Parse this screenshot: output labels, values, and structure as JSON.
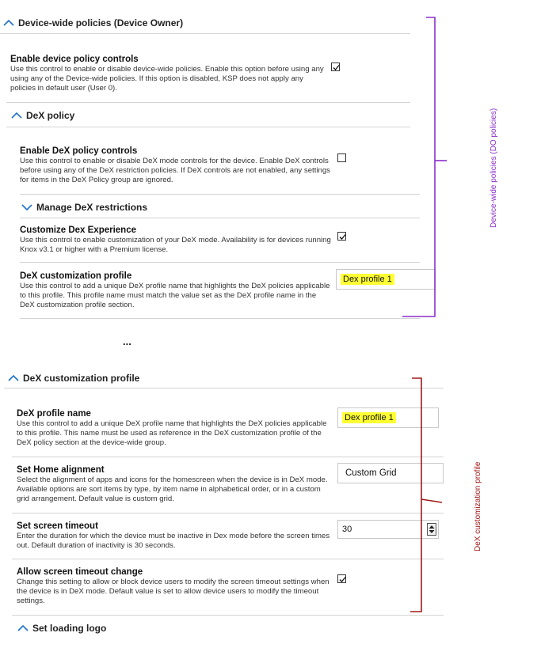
{
  "device_wide": {
    "header": "Device-wide policies (Device Owner)",
    "enable_policy": {
      "title": "Enable device policy controls",
      "desc": "Use this control to enable or disable device-wide policies. Enable this option before using any using any of the Device-wide policies. If this option is disabled, KSP does not apply any policies in default user (User 0).",
      "checked": true
    },
    "dex_policy": {
      "header": "DeX policy",
      "enable_dex": {
        "title": "Enable DeX policy controls",
        "desc": "Use this control to enable or disable DeX mode controls for the device. Enable DeX controls before using any of the DeX restriction policies. If DeX controls are not enabled, any settings for items in the DeX Policy group are ignored.",
        "checked": false
      },
      "manage_restrictions": "Manage DeX restrictions",
      "customize": {
        "title": "Customize Dex Experience",
        "desc": "Use this control to enable customization of your DeX mode. Availability is for devices running Knox v3.1 or higher with a Premium license.",
        "checked": true
      },
      "customization_profile": {
        "title": "DeX customization profile",
        "desc": "Use this control to add a unique DeX profile name that highlights the DeX policies applicable to this profile. This profile name must match the value set as the DeX profile name in the DeX customization profile section.",
        "value": "Dex profile 1"
      }
    }
  },
  "ellipsis": "...",
  "dex_profile": {
    "header": "DeX customization profile",
    "profile_name": {
      "title": "DeX profile name",
      "desc": "Use this control to add a unique DeX profile name that highlights the DeX policies applicable to this profile. This name must be used as reference in the DeX customization profile of the DeX policy section at the device-wide group.",
      "value": "Dex profile 1"
    },
    "home_alignment": {
      "title": "Set Home alignment",
      "desc": "Select the alignment of apps and icons for the homescreen when the device is in DeX mode. Available options are sort items by type, by item name in alphabetical order, or in a custom grid arrangement. Default value is custom grid.",
      "value": "Custom Grid"
    },
    "screen_timeout": {
      "title": "Set screen timeout",
      "desc": "Enter the duration for which the device must be inactive in Dex mode before the screen times out. Default duration of inactivity is 30 seconds.",
      "value": "30"
    },
    "allow_timeout_change": {
      "title": "Allow screen timeout change",
      "desc": "Change this setting to allow or block device users to modify the screen timeout settings when the device is in DeX mode. Default value is set to allow device users to modify the timeout settings.",
      "checked": true
    },
    "loading_logo": "Set loading logo"
  },
  "annotations": {
    "top_label": "Device-wide policies (DO policies)",
    "bottom_label": "DeX customization profile",
    "top_color": "#8b2fc9",
    "bottom_color": "#a01818"
  }
}
